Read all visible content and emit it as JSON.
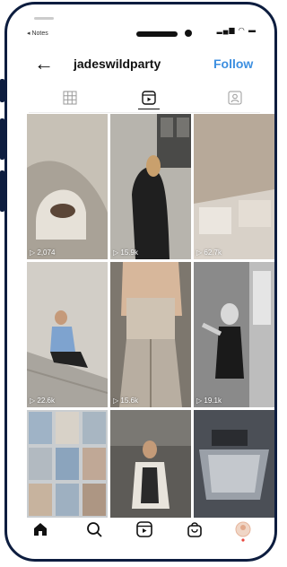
{
  "status_bar": {
    "back_app": "◂ Notes",
    "signal_icons": "▂▄▆ ◠ ▬"
  },
  "header": {
    "back_icon": "←",
    "username": "jadeswildparty",
    "follow": "Follow"
  },
  "tabs": [
    "grid-tab",
    "reels-tab",
    "tagged-tab"
  ],
  "reels": [
    {
      "views": "▷ 2,074",
      "tone": "#b9b3aa"
    },
    {
      "views": "▷ 15.9k",
      "tone": "#9a968f"
    },
    {
      "views": "▷ 62.7k",
      "tone": "#bfb3a6"
    },
    {
      "views": "▷ 22.6k",
      "tone": "#c5c0b8"
    },
    {
      "views": "▷ 15.6k",
      "tone": "#8f877c"
    },
    {
      "views": "▷ 19.1k",
      "tone": "#6f6f6f"
    },
    {
      "views": "",
      "tone": "#a3aab0"
    },
    {
      "views": "",
      "tone": "#6c6a66"
    },
    {
      "views": "",
      "tone": "#3e4249"
    }
  ],
  "nav": [
    "home-icon",
    "search-icon",
    "reels-icon",
    "shop-icon",
    "profile-icon"
  ]
}
